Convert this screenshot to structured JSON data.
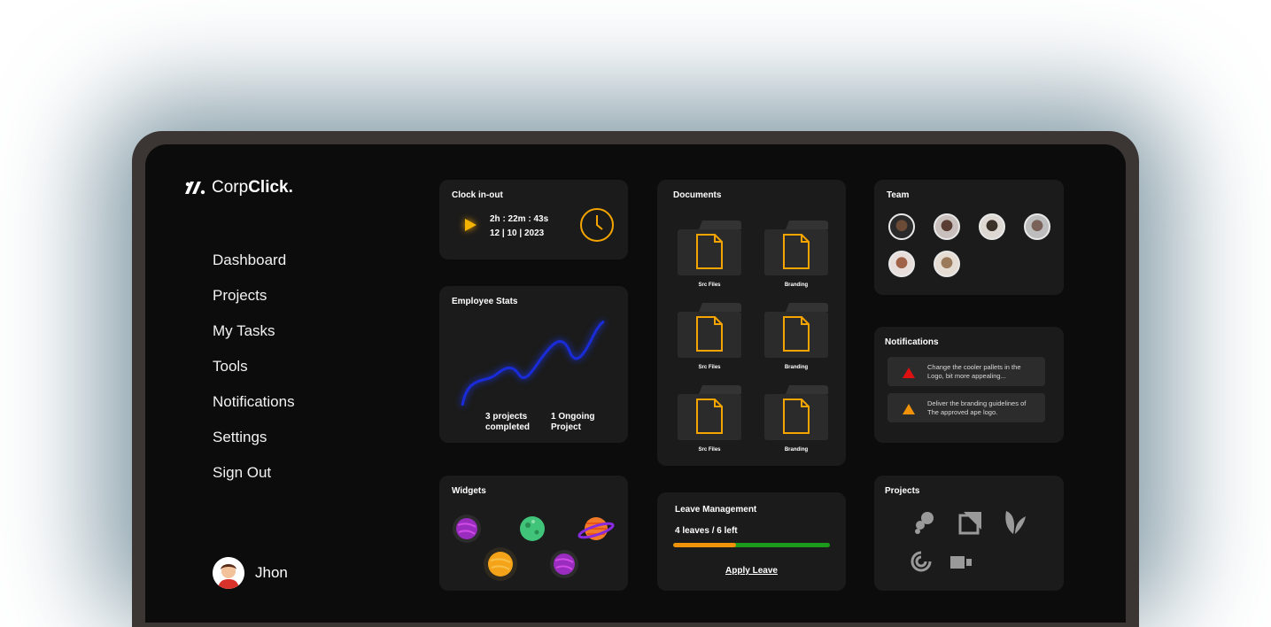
{
  "brand": {
    "light": "Corp",
    "bold": "Click."
  },
  "nav": {
    "items": [
      "Dashboard",
      "Projects",
      "My Tasks",
      "Tools",
      "Notifications",
      "Settings",
      "Sign Out"
    ]
  },
  "user": {
    "name": "Jhon"
  },
  "clock": {
    "title": "Clock in-out",
    "time": "2h : 22m : 43s",
    "date": "12 | 10 | 2023"
  },
  "stats": {
    "title": "Employee Stats",
    "completed_line1": "3 projects",
    "completed_line2": "completed",
    "ongoing_line1": "1 Ongoing",
    "ongoing_line2": "Project"
  },
  "widgets": {
    "title": "Widgets"
  },
  "documents": {
    "title": "Documents",
    "items": [
      "Src Files",
      "Branding",
      "Src Files",
      "Branding",
      "Src Files",
      "Branding"
    ]
  },
  "leave": {
    "title": "Leave Management",
    "summary": "4 leaves / 6 left",
    "used_fraction": 0.4,
    "apply_label": "Apply Leave"
  },
  "team": {
    "title": "Team",
    "member_count": 6
  },
  "notifications": {
    "title": "Notifications",
    "items": [
      {
        "line1": "Change the cooler pallets in the",
        "line2": "Logo, bit more appealing...",
        "color": "#e01010"
      },
      {
        "line1": "Deliver the branding guidelines of",
        "line2": "The approved ape logo.",
        "color": "#f0930a"
      }
    ]
  },
  "projects": {
    "title": "Projects"
  },
  "colors": {
    "accent": "#f5a400",
    "screen": "#0c0c0c",
    "card": "#1b1b1b",
    "chart_line": "#1a2bd8"
  }
}
